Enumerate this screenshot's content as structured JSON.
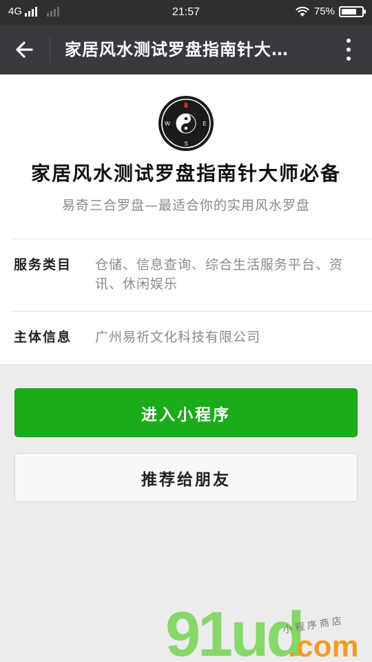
{
  "status_bar": {
    "network": "4G",
    "time": "21:57",
    "battery_text": "75%",
    "battery_level": 0.75
  },
  "nav": {
    "title": "家居风水测试罗盘指南针大…",
    "back_icon": "arrow-left-icon",
    "more_icon": "more-vertical-icon"
  },
  "app": {
    "logo_icon": "compass-yin-yang-icon",
    "compass_letters": {
      "n": "N",
      "s": "S",
      "e": "E",
      "w": "W"
    },
    "name": "家居风水测试罗盘指南针大师必备",
    "description": "易奇三合罗盘—最适合你的实用风水罗盘"
  },
  "info": {
    "service_label": "服务类目",
    "service_value": "仓储、信息查询、综合生活服务平台、资讯、休闲娱乐",
    "entity_label": "主体信息",
    "entity_value": "广州易祈文化科技有限公司"
  },
  "buttons": {
    "enter": "进入小程序",
    "recommend": "推荐给朋友"
  },
  "watermark": {
    "logo": "91ud",
    "domain": ".com",
    "store": "小程序商店"
  },
  "colors": {
    "status_bar_bg": "#2f2f31",
    "nav_bg": "#393a3f",
    "primary_green": "#1aad19",
    "page_bg": "#ececec"
  }
}
